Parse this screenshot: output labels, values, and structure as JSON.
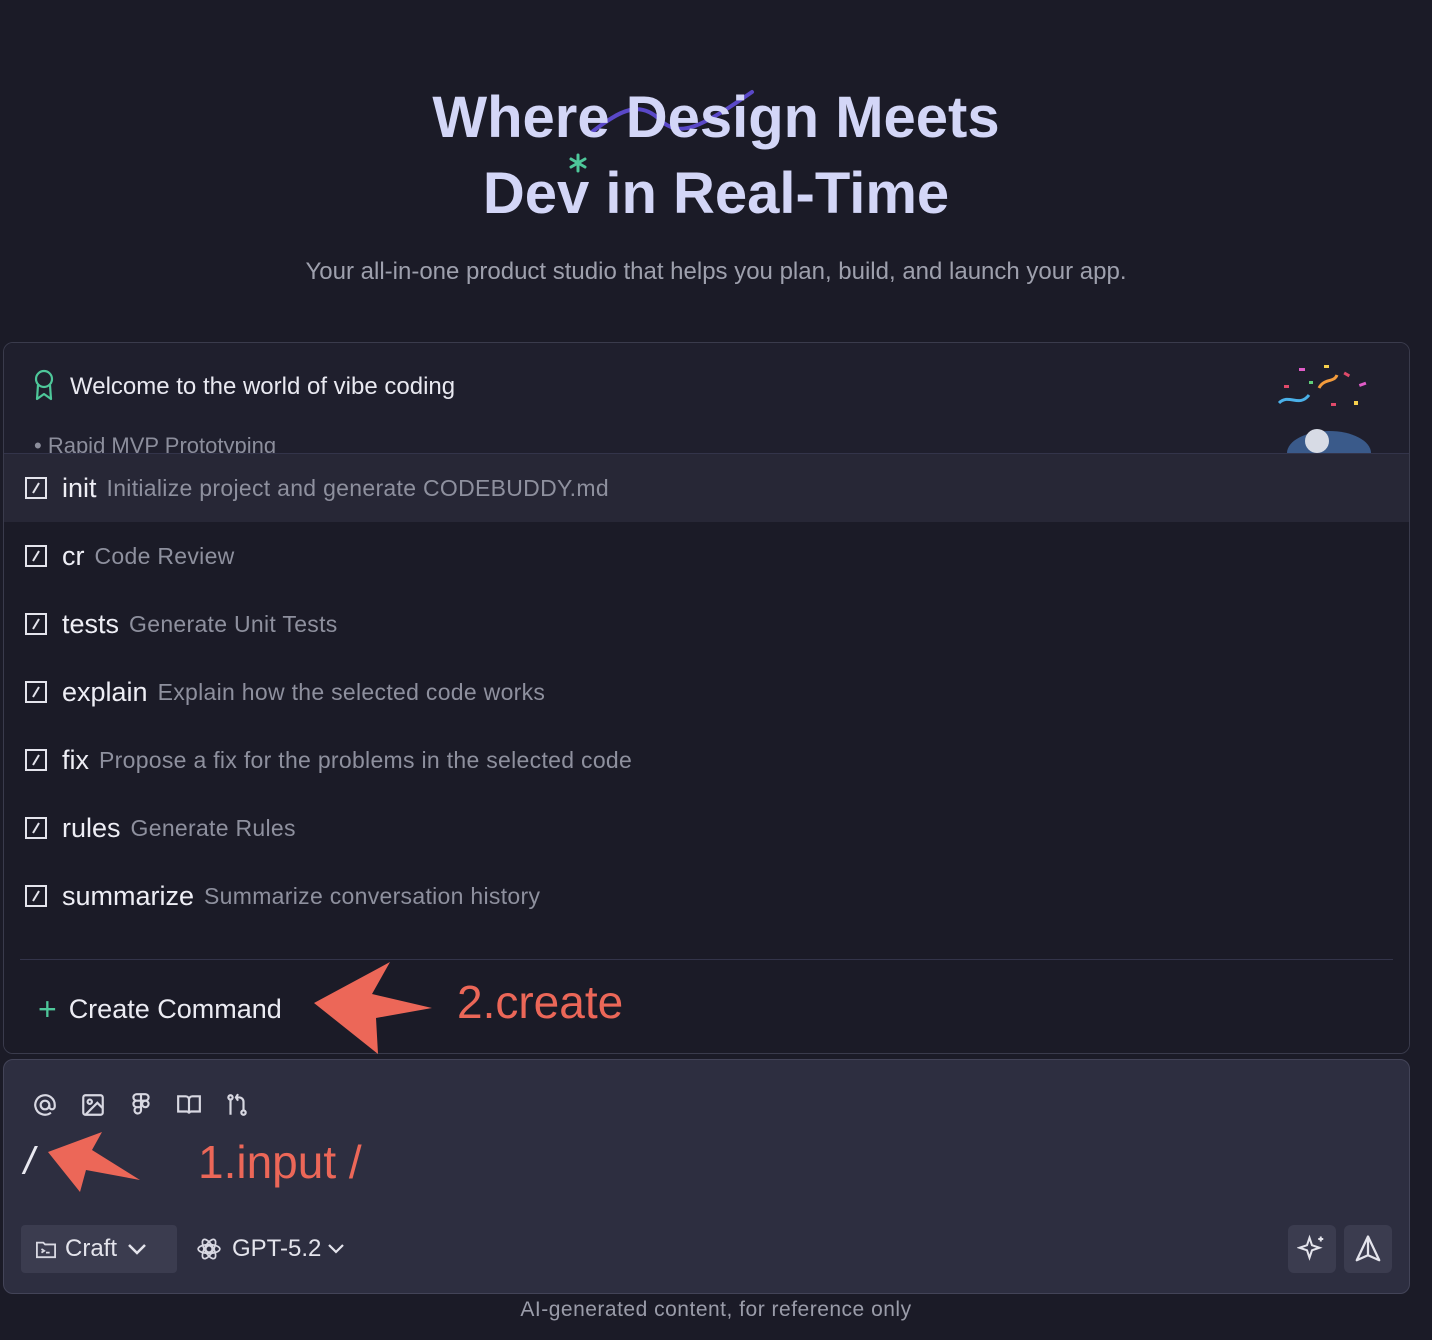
{
  "hero": {
    "title_line1": "Where Design Meets",
    "title_line2": "Dev in Real-Time",
    "subtitle": "Your all-in-one product studio that helps you plan, build, and launch your app."
  },
  "welcome": {
    "icon": "award-ribbon-icon",
    "title": "Welcome to the world of vibe coding",
    "bullet": "Rapid MVP Prototyping"
  },
  "commands": [
    {
      "name": "init",
      "desc": "Initialize project and generate CODEBUDDY.md",
      "active": true
    },
    {
      "name": "cr",
      "desc": "Code Review"
    },
    {
      "name": "tests",
      "desc": "Generate Unit Tests"
    },
    {
      "name": "explain",
      "desc": "Explain how the selected code works"
    },
    {
      "name": "fix",
      "desc": "Propose a fix for the problems in the selected code"
    },
    {
      "name": "rules",
      "desc": "Generate Rules"
    },
    {
      "name": "summarize",
      "desc": "Summarize conversation history"
    }
  ],
  "create_command": {
    "label": "Create Command",
    "icon": "plus-icon"
  },
  "annotations": {
    "create": "2.create",
    "input": "1.input /"
  },
  "input": {
    "value": "/",
    "tools": [
      "at-mention-icon",
      "image-upload-icon",
      "figma-icon",
      "book-icon",
      "git-branch-icon"
    ],
    "mode": "Craft",
    "model": "GPT-5.2"
  },
  "footer": "AI-generated content, for reference only",
  "colors": {
    "accent_green": "#4ec79a",
    "annotation_red": "#ec6758",
    "hero_text": "#d3d6f7"
  }
}
